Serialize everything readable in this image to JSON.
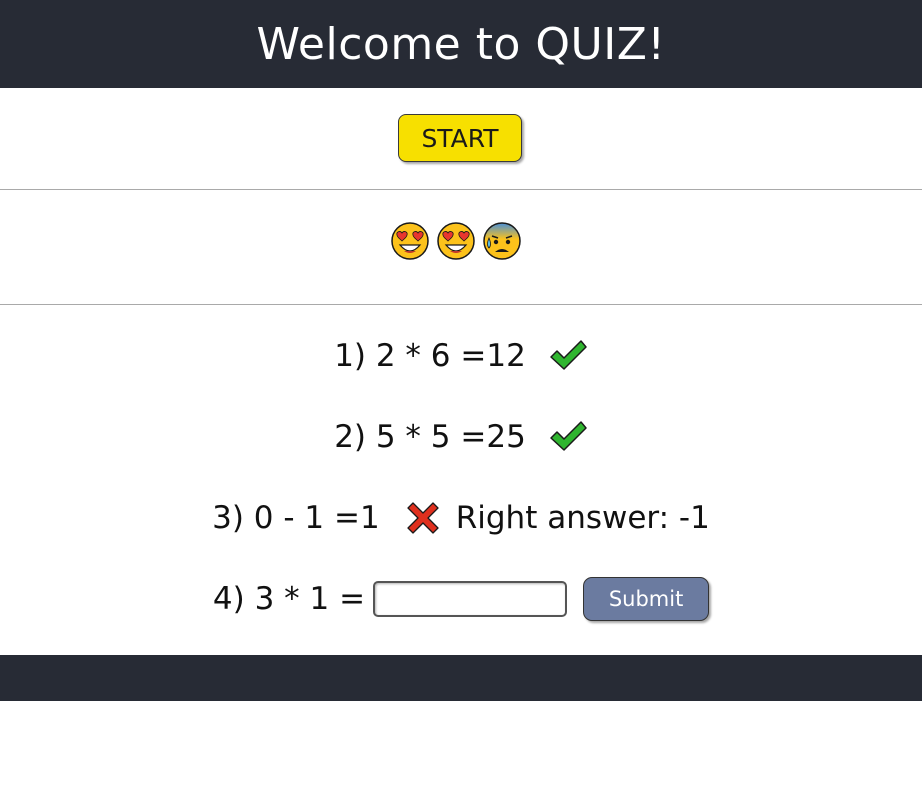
{
  "header": {
    "title": "Welcome to QUIZ!"
  },
  "controls": {
    "start_label": "START"
  },
  "score_emojis": [
    {
      "icon": "heart-eyes-emoji"
    },
    {
      "icon": "heart-eyes-emoji"
    },
    {
      "icon": "anxious-sweat-emoji"
    }
  ],
  "questions": [
    {
      "text": "1) 2 * 6 =12",
      "result": "correct",
      "result_icon": "check-icon"
    },
    {
      "text": "2) 5 * 5 =25",
      "result": "correct",
      "result_icon": "check-icon"
    },
    {
      "text": "3) 0 - 1 =1",
      "result": "wrong",
      "result_icon": "cross-icon",
      "right_answer": "Right answer: -1"
    },
    {
      "text": "4) 3 * 1 =",
      "input_value": "",
      "submit_label": "Submit"
    }
  ],
  "colors": {
    "header_bg": "#272b35",
    "start_button": "#f7e000",
    "submit_button": "#6b7ba0",
    "correct": "#2fb52f",
    "wrong": "#e0301e"
  }
}
